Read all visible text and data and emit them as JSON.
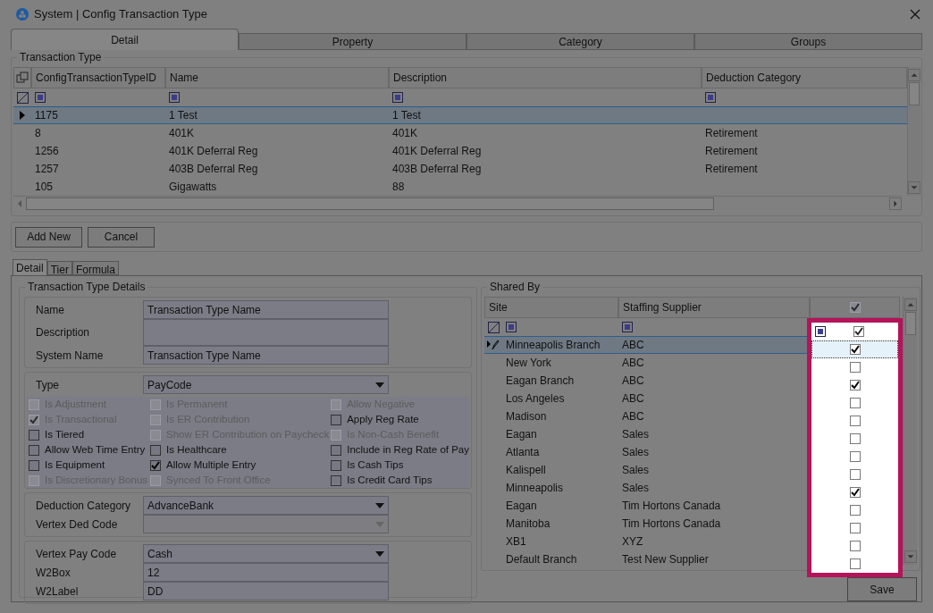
{
  "window": {
    "title": "System | Config Transaction Type"
  },
  "tabs": [
    {
      "label": "Detail",
      "selected": true
    },
    {
      "label": "Property",
      "selected": false
    },
    {
      "label": "Category",
      "selected": false
    },
    {
      "label": "Groups",
      "selected": false
    }
  ],
  "transaction_type": {
    "title": "Transaction Type",
    "columns": [
      "ConfigTransactionTypeID",
      "Name",
      "Description",
      "Deduction Category"
    ],
    "rows": [
      {
        "cells": [
          "1175",
          "1 Test",
          "1 Test",
          ""
        ],
        "selected": true
      },
      {
        "cells": [
          "8",
          "401K",
          "401K",
          "Retirement"
        ],
        "selected": false
      },
      {
        "cells": [
          "1256",
          "401K Deferral Reg",
          "401K Deferral Reg",
          "Retirement"
        ],
        "selected": false
      },
      {
        "cells": [
          "1257",
          "403B Deferral Reg",
          "403B Deferral Reg",
          "Retirement"
        ],
        "selected": false
      },
      {
        "cells": [
          "105",
          "Gigawatts",
          "88",
          ""
        ],
        "selected": false
      }
    ]
  },
  "buttons": [
    "Add New",
    "Cancel"
  ],
  "sub_tabs": [
    {
      "label": "Detail",
      "selected": true
    },
    {
      "label": "Tier",
      "selected": false
    },
    {
      "label": "Formula",
      "selected": false
    }
  ],
  "details": {
    "title": "Transaction Type Details",
    "name_fields": [
      {
        "label": "Name",
        "value": "Transaction Type Name",
        "kind": "text"
      },
      {
        "label": "Description",
        "kind": "textarea"
      },
      {
        "label": "System Name",
        "value": "Transaction Type Name",
        "kind": "text"
      }
    ],
    "type": {
      "label": "Type",
      "value": "PayCode"
    },
    "checkbox_columns": [
      [
        {
          "label": "Is Adjustment",
          "checked": false,
          "disabled": true
        },
        {
          "label": "Is Transactional",
          "checked": true,
          "disabled": true
        },
        {
          "label": "Is Tiered",
          "checked": false,
          "disabled": false
        },
        {
          "label": "Allow Web Time Entry",
          "checked": false,
          "disabled": false
        },
        {
          "label": "Is Equipment",
          "checked": false,
          "disabled": false
        },
        {
          "label": "Is Discretionary Bonus",
          "checked": false,
          "disabled": true
        }
      ],
      [
        {
          "label": "Is Permanent",
          "checked": false,
          "disabled": true
        },
        {
          "label": "Is ER Contribution",
          "checked": false,
          "disabled": true
        },
        {
          "label": "Show ER Contribution on Paycheck",
          "checked": false,
          "disabled": true
        },
        {
          "label": "Is Healthcare",
          "checked": false,
          "disabled": false
        },
        {
          "label": "Allow Multiple Entry",
          "checked": true,
          "disabled": false
        },
        {
          "label": "Synced To Front Office",
          "checked": false,
          "disabled": true
        }
      ],
      [
        {
          "label": "Allow Negative",
          "checked": false,
          "disabled": true
        },
        {
          "label": "Apply Reg Rate",
          "checked": false,
          "disabled": false
        },
        {
          "label": "Is Non-Cash Benefit",
          "checked": false,
          "disabled": true
        },
        {
          "label": "Include in Reg Rate of Pay",
          "checked": false,
          "disabled": false
        },
        {
          "label": "Is Cash Tips",
          "checked": false,
          "disabled": false
        },
        {
          "label": "Is Credit Card Tips",
          "checked": false,
          "disabled": false
        }
      ]
    ],
    "deduction_fields": [
      {
        "label": "Deduction Category",
        "value": "AdvanceBank",
        "kind": "combo",
        "disabled": false
      },
      {
        "label": "Vertex Ded Code",
        "kind": "combo",
        "disabled": true
      }
    ],
    "pay_fields": [
      {
        "label": "Vertex Pay Code",
        "value": "Cash",
        "kind": "combo",
        "disabled": false
      },
      {
        "label": "W2Box",
        "value": "12",
        "kind": "text"
      },
      {
        "label": "W2Label",
        "value": "DD",
        "kind": "text"
      }
    ]
  },
  "shared_by": {
    "title": "Shared By",
    "columns": [
      "Site",
      "Staffing Supplier"
    ],
    "header_checked": true,
    "filter_checked": true,
    "highlighted": true,
    "rows": [
      {
        "site": "Minneapolis Branch",
        "supplier": "ABC",
        "checked": true,
        "selected": true
      },
      {
        "site": "New York",
        "supplier": "ABC",
        "checked": false,
        "selected": false
      },
      {
        "site": "Eagan Branch",
        "supplier": "ABC",
        "checked": true,
        "selected": false
      },
      {
        "site": "Los Angeles",
        "supplier": "ABC",
        "checked": false,
        "selected": false
      },
      {
        "site": "Madison",
        "supplier": "ABC",
        "checked": false,
        "selected": false
      },
      {
        "site": "Eagan",
        "supplier": "Sales",
        "checked": false,
        "selected": false
      },
      {
        "site": "Atlanta",
        "supplier": "Sales",
        "checked": false,
        "selected": false
      },
      {
        "site": "Kalispell",
        "supplier": "Sales",
        "checked": false,
        "selected": false
      },
      {
        "site": "Minneapolis",
        "supplier": "Sales",
        "checked": true,
        "selected": false
      },
      {
        "site": "Eagan",
        "supplier": "Tim Hortons Canada",
        "checked": false,
        "selected": false
      },
      {
        "site": "Manitoba",
        "supplier": "Tim Hortons Canada",
        "checked": false,
        "selected": false
      },
      {
        "site": "XB1",
        "supplier": "XYZ",
        "checked": false,
        "selected": false
      },
      {
        "site": "Default Branch",
        "supplier": "Test New Supplier",
        "checked": false,
        "selected": false
      }
    ]
  },
  "save_button": "Save"
}
